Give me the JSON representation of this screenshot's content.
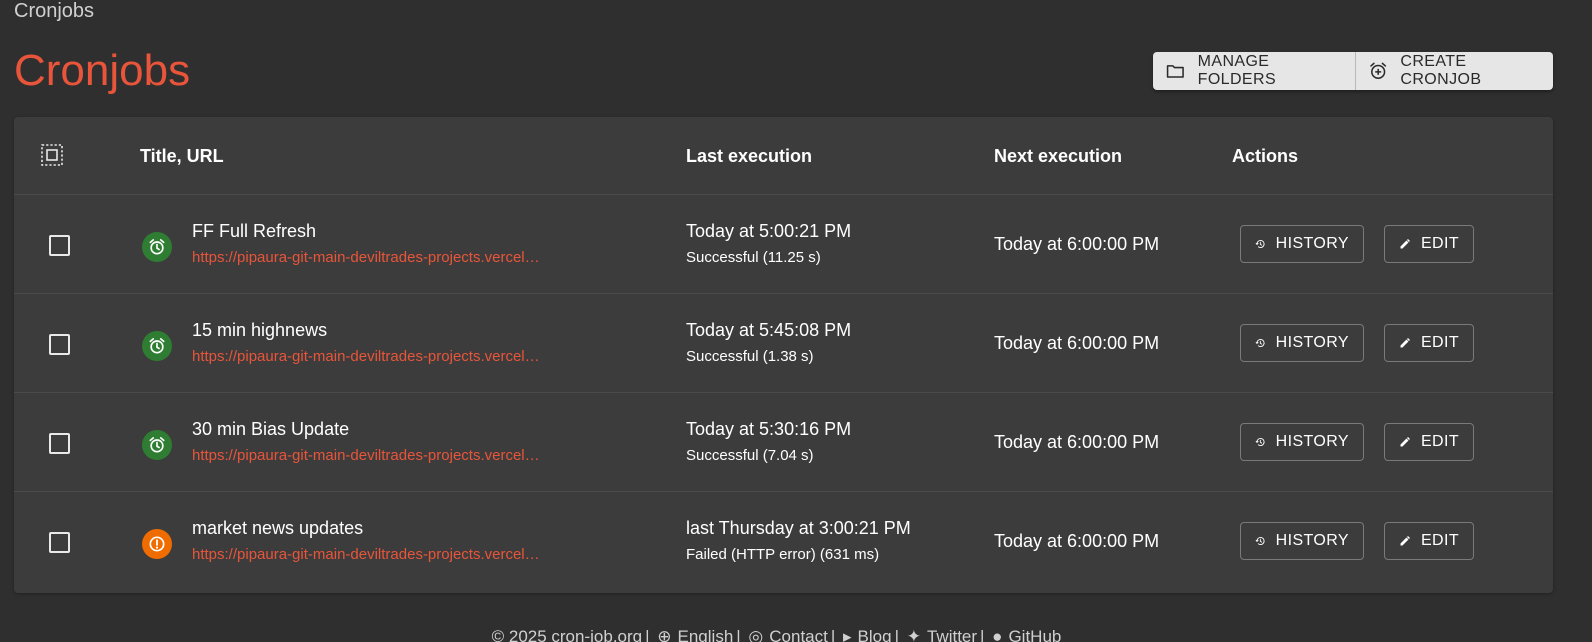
{
  "breadcrumb": "Cronjobs",
  "page_title": "Cronjobs",
  "toolbar": {
    "manage_folders": "MANAGE FOLDERS",
    "create_cronjob": "CREATE CRONJOB"
  },
  "table": {
    "headers": {
      "title_url": "Title, URL",
      "last_execution": "Last execution",
      "next_execution": "Next execution",
      "actions": "Actions"
    },
    "rows": [
      {
        "title": "FF Full Refresh",
        "url": "https://pipaura-git-main-deviltrades-projects.vercel…",
        "status": "ok",
        "last_execution": "Today at 5:00:21 PM",
        "last_status": "Successful (11.25 s)",
        "next_execution": "Today at 6:00:00 PM",
        "history_label": "HISTORY",
        "edit_label": "EDIT"
      },
      {
        "title": "15 min highnews",
        "url": "https://pipaura-git-main-deviltrades-projects.vercel…",
        "status": "ok",
        "last_execution": "Today at 5:45:08 PM",
        "last_status": "Successful (1.38 s)",
        "next_execution": "Today at 6:00:00 PM",
        "history_label": "HISTORY",
        "edit_label": "EDIT"
      },
      {
        "title": "30 min Bias Update",
        "url": "https://pipaura-git-main-deviltrades-projects.vercel…",
        "status": "ok",
        "last_execution": "Today at 5:30:16 PM",
        "last_status": "Successful (7.04 s)",
        "next_execution": "Today at 6:00:00 PM",
        "history_label": "HISTORY",
        "edit_label": "EDIT"
      },
      {
        "title": "market news updates",
        "url": "https://pipaura-git-main-deviltrades-projects.vercel…",
        "status": "fail",
        "last_execution": "last Thursday at 3:00:21 PM",
        "last_status": "Failed (HTTP error) (631 ms)",
        "next_execution": "Today at 6:00:00 PM",
        "history_label": "HISTORY",
        "edit_label": "EDIT"
      }
    ]
  },
  "footer": {
    "copyright": "© 2025 cron-job.org",
    "language": "English",
    "contact": "Contact",
    "blog": "Blog",
    "twitter": "Twitter",
    "github": "GitHub"
  },
  "colors": {
    "accent": "#e8553a",
    "success": "#2e7d32",
    "failure": "#ef6c00",
    "background": "#2f2f2f",
    "card": "#3c3c3c"
  }
}
